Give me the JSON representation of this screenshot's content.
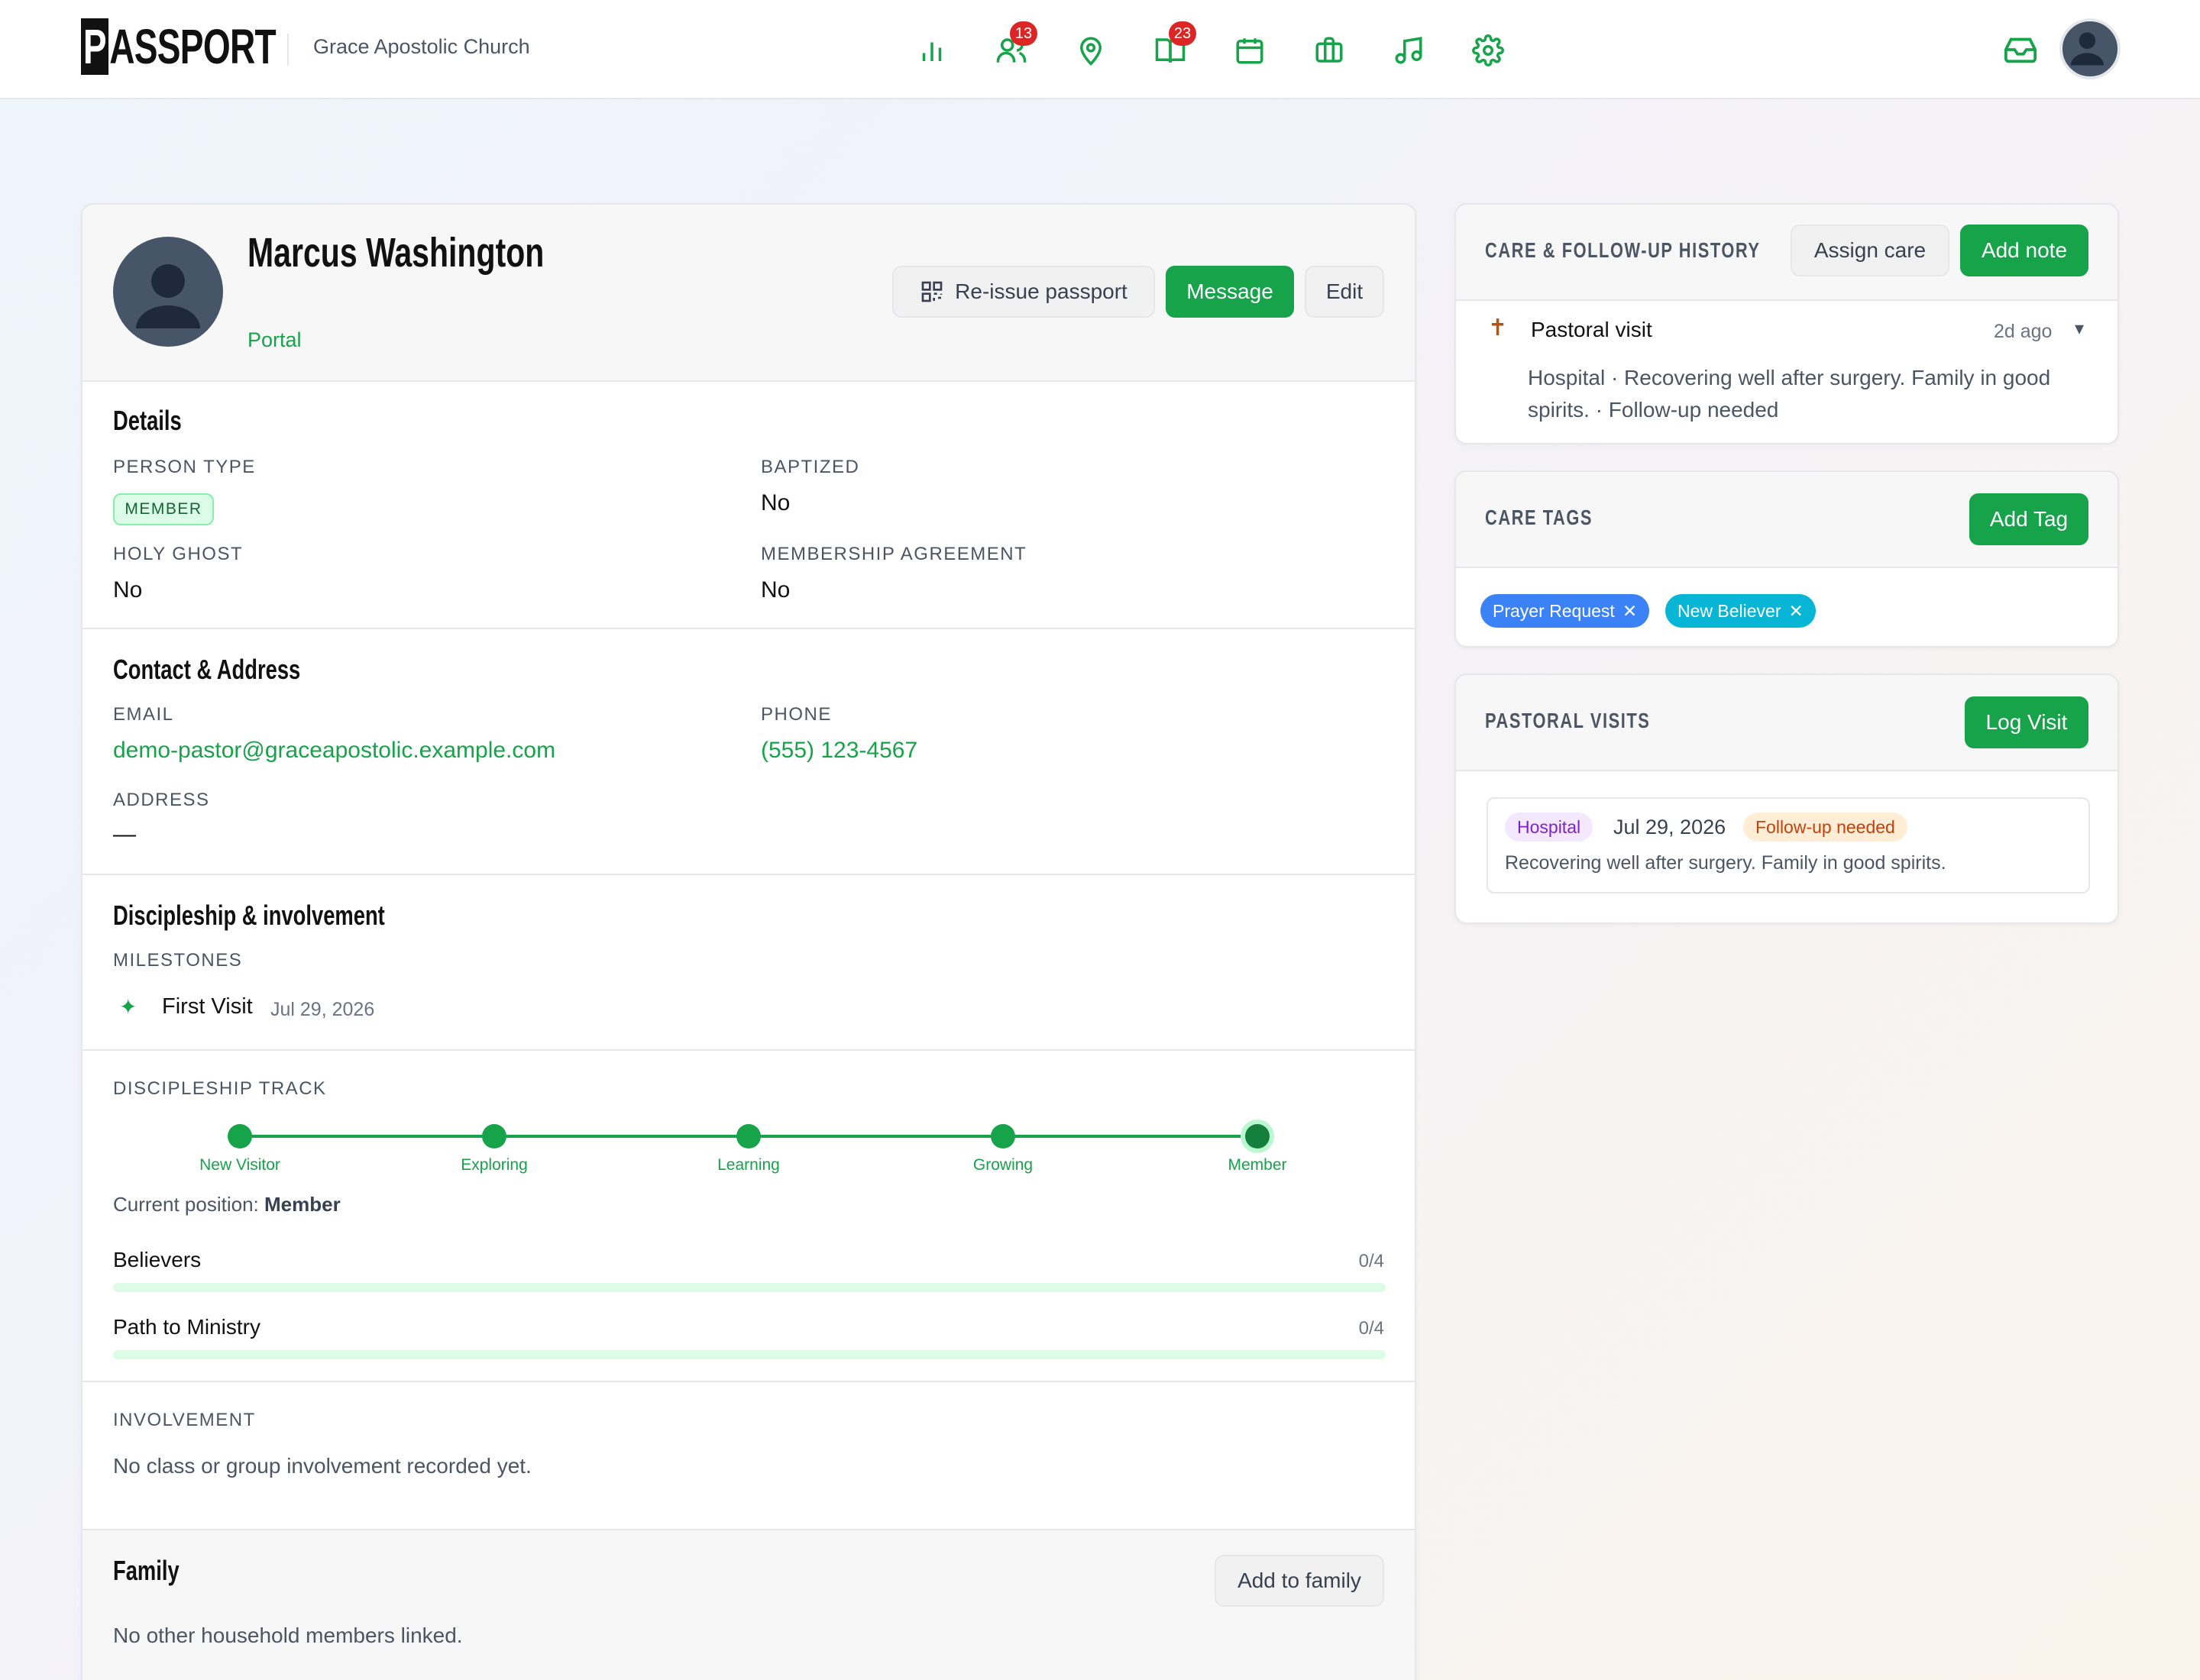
{
  "app": {
    "logo": "PASSPORT",
    "logo_first": "P",
    "logo_rest": "ASSPORT",
    "church": "Grace Apostolic Church"
  },
  "nav": {
    "icons": [
      "bar-chart-icon",
      "users-icon",
      "map-pin-icon",
      "book-open-icon",
      "calendar-icon",
      "briefcase-icon",
      "music-icon",
      "settings-icon"
    ],
    "users_badge": "13",
    "book_badge": "23"
  },
  "colors": {
    "accent": "#16a34a",
    "badge": "#dc2626",
    "tag_blue": "#3b82f6",
    "tag_cyan": "#06b6d4"
  },
  "profile": {
    "name": "Marcus Washington",
    "portal": "Portal",
    "actions": {
      "reissue": "Re-issue passport",
      "message": "Message",
      "edit": "Edit"
    }
  },
  "details": {
    "title": "Details",
    "person_type_label": "PERSON TYPE",
    "person_type": "MEMBER",
    "baptized_label": "BAPTIZED",
    "baptized": "No",
    "holy_ghost_label": "HOLY GHOST",
    "holy_ghost": "No",
    "agreement_label": "MEMBERSHIP AGREEMENT",
    "agreement": "No"
  },
  "contact": {
    "title": "Contact & Address",
    "email_label": "EMAIL",
    "email": "demo-pastor@graceapostolic.example.com",
    "phone_label": "PHONE",
    "phone": "(555) 123-4567",
    "address_label": "ADDRESS",
    "address": "—"
  },
  "discipleship": {
    "title": "Discipleship & involvement",
    "milestones_label": "MILESTONES",
    "milestone_icon": "✦",
    "milestone_name": "First Visit",
    "milestone_date": "Jul 29, 2026",
    "track_label": "DISCIPLESHIP TRACK",
    "stages": [
      "New Visitor",
      "Exploring",
      "Learning",
      "Growing",
      "Member"
    ],
    "current_prefix": "Current position:",
    "current": "Member",
    "paths": [
      {
        "name": "Believers",
        "progress": "0/4",
        "fraction": 0
      },
      {
        "name": "Path to Ministry",
        "progress": "0/4",
        "fraction": 0
      }
    ],
    "involvement_label": "INVOLVEMENT",
    "involvement_empty": "No class or group involvement recorded yet."
  },
  "family": {
    "title": "Family",
    "add": "Add to family",
    "empty": "No other household members linked."
  },
  "care": {
    "title": "CARE & FOLLOW-UP HISTORY",
    "assign": "Assign care",
    "add_note": "Add note",
    "entry_icon": "✝",
    "entry_title": "Pastoral visit",
    "entry_time": "2d ago",
    "entry_caret": "▾",
    "entry_body": "Hospital · Recovering well after surgery. Family in good spirits. · Follow-up needed"
  },
  "tags": {
    "title": "CARE TAGS",
    "add": "Add Tag",
    "items": [
      {
        "label": "Prayer Request",
        "remove": "✕"
      },
      {
        "label": "New Believer",
        "remove": "✕"
      }
    ]
  },
  "visits": {
    "title": "PASTORAL VISITS",
    "log": "Log Visit",
    "type": "Hospital",
    "date": "Jul 29, 2026",
    "status": "Follow-up needed",
    "note": "Recovering well after surgery. Family in good spirits."
  }
}
